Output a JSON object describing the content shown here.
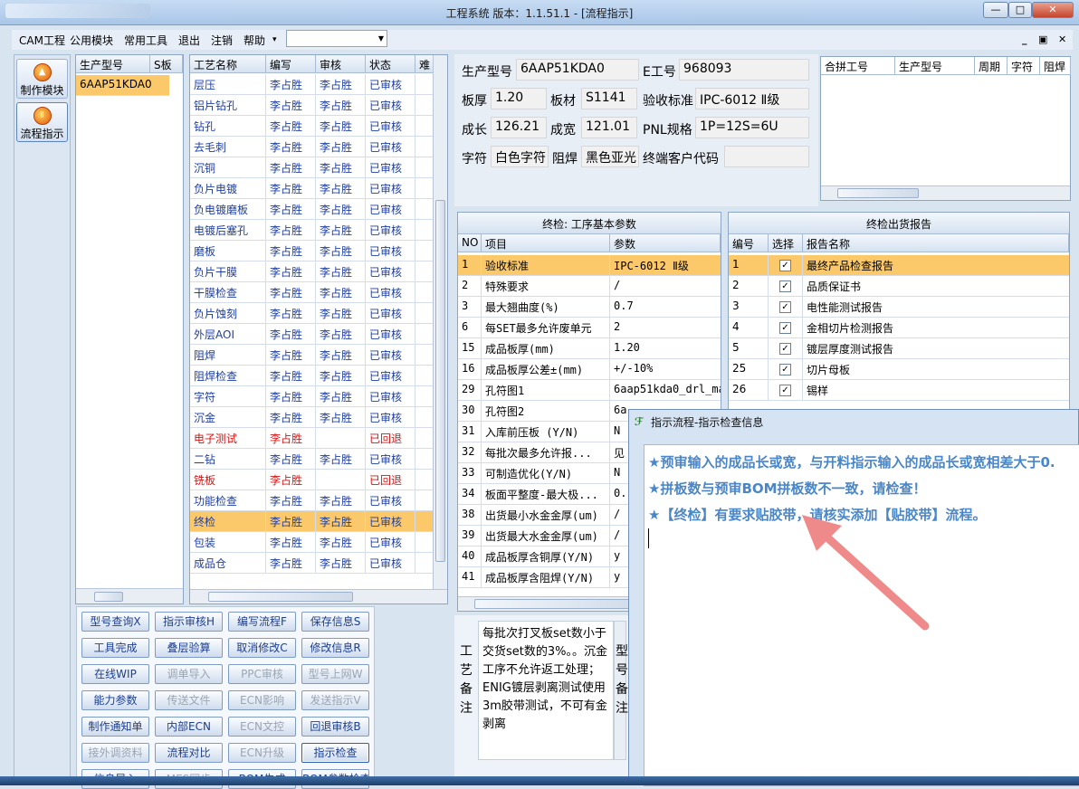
{
  "window": {
    "title": "工程系统  版本：1.1.51.1 - [流程指示]",
    "min": "—",
    "max": "□",
    "close": "✕"
  },
  "menu": {
    "items": [
      "CAM工程",
      "公用模块",
      "常用工具",
      "退出",
      "注销",
      "帮助"
    ],
    "help_arrow": "▾",
    "combo_value": "",
    "combo_arrow": "▼",
    "mdi_min": "_",
    "mdi_restore": "▣",
    "mdi_close": "✕"
  },
  "left_tools": [
    {
      "label": "制作模块",
      "icon": "flame-icon"
    },
    {
      "label": "流程指示",
      "icon": "pause-icon"
    }
  ],
  "model_list": {
    "headers": [
      "生产型号",
      "S板"
    ],
    "rows": [
      [
        "6AAP51KDA0",
        ""
      ]
    ]
  },
  "process": {
    "headers": [
      "工艺名称",
      "编写",
      "审核",
      "状态",
      "难"
    ],
    "rows": [
      {
        "name": "层压",
        "writer": "李占胜",
        "checker": "李占胜",
        "status": "已审核",
        "red": false
      },
      {
        "name": "铝片钻孔",
        "writer": "李占胜",
        "checker": "李占胜",
        "status": "已审核",
        "red": false
      },
      {
        "name": "钻孔",
        "writer": "李占胜",
        "checker": "李占胜",
        "status": "已审核",
        "red": false
      },
      {
        "name": "去毛刺",
        "writer": "李占胜",
        "checker": "李占胜",
        "status": "已审核",
        "red": false
      },
      {
        "name": "沉铜",
        "writer": "李占胜",
        "checker": "李占胜",
        "status": "已审核",
        "red": false
      },
      {
        "name": "负片电镀",
        "writer": "李占胜",
        "checker": "李占胜",
        "status": "已审核",
        "red": false
      },
      {
        "name": "负电镀磨板",
        "writer": "李占胜",
        "checker": "李占胜",
        "status": "已审核",
        "red": false
      },
      {
        "name": "电镀后塞孔",
        "writer": "李占胜",
        "checker": "李占胜",
        "status": "已审核",
        "red": false
      },
      {
        "name": "磨板",
        "writer": "李占胜",
        "checker": "李占胜",
        "status": "已审核",
        "red": false
      },
      {
        "name": "负片干膜",
        "writer": "李占胜",
        "checker": "李占胜",
        "status": "已审核",
        "red": false
      },
      {
        "name": "干膜检查",
        "writer": "李占胜",
        "checker": "李占胜",
        "status": "已审核",
        "red": false
      },
      {
        "name": "负片蚀刻",
        "writer": "李占胜",
        "checker": "李占胜",
        "status": "已审核",
        "red": false
      },
      {
        "name": "外层AOI",
        "writer": "李占胜",
        "checker": "李占胜",
        "status": "已审核",
        "red": false
      },
      {
        "name": "阻焊",
        "writer": "李占胜",
        "checker": "李占胜",
        "status": "已审核",
        "red": false
      },
      {
        "name": "阻焊检查",
        "writer": "李占胜",
        "checker": "李占胜",
        "status": "已审核",
        "red": false
      },
      {
        "name": "字符",
        "writer": "李占胜",
        "checker": "李占胜",
        "status": "已审核",
        "red": false
      },
      {
        "name": "沉金",
        "writer": "李占胜",
        "checker": "李占胜",
        "status": "已审核",
        "red": false
      },
      {
        "name": "电子测试",
        "writer": "李占胜",
        "checker": "",
        "status": "已回退",
        "red": true
      },
      {
        "name": "二钻",
        "writer": "李占胜",
        "checker": "李占胜",
        "status": "已审核",
        "red": false
      },
      {
        "name": "铣板",
        "writer": "李占胜",
        "checker": "",
        "status": "已回退",
        "red": true
      },
      {
        "name": "功能检查",
        "writer": "李占胜",
        "checker": "李占胜",
        "status": "已审核",
        "red": false
      },
      {
        "name": "终检",
        "writer": "李占胜",
        "checker": "李占胜",
        "status": "已审核",
        "red": false,
        "selected": true
      },
      {
        "name": "包装",
        "writer": "李占胜",
        "checker": "李占胜",
        "status": "已审核",
        "red": false
      },
      {
        "name": "成品仓",
        "writer": "李占胜",
        "checker": "李占胜",
        "status": "已审核",
        "red": false
      }
    ]
  },
  "info": {
    "model_label": "生产型号",
    "model": "6AAP51KDA0",
    "eno_label": "E工号",
    "eno": "968093",
    "thick_label": "板厚",
    "thick": "1.20",
    "material_label": "板材",
    "material": "S1141",
    "std_label": "验收标准",
    "std": "IPC-6012 Ⅱ级",
    "len_label": "成长",
    "len": "126.21",
    "width_label": "成宽",
    "width": "121.01",
    "pnl_label": "PNL规格",
    "pnl": "1P=12S=6U",
    "char_label": "字符",
    "char": "白色字符",
    "mask_label": "阻焊",
    "mask": "黑色亚光",
    "cust_label": "终端客户代码",
    "cust": ""
  },
  "merge_table": {
    "headers": [
      "合拼工号",
      "生产型号",
      "周期",
      "字符",
      "阻焊"
    ]
  },
  "params": {
    "title": "终检: 工序基本参数",
    "headers": [
      "NO",
      "项目",
      "参数"
    ],
    "rows": [
      [
        "1",
        "验收标准",
        "IPC-6012 Ⅱ级"
      ],
      [
        "2",
        "特殊要求",
        "/"
      ],
      [
        "3",
        "最大翘曲度(%)",
        "0.7"
      ],
      [
        "6",
        "每SET最多允许废单元",
        "2"
      ],
      [
        "15",
        "成品板厚(mm)",
        "1.20"
      ],
      [
        "16",
        "成品板厚公差±(mm)",
        "+/-10%"
      ],
      [
        "29",
        "孔符图1",
        "6aap51kda0_drl_ma"
      ],
      [
        "30",
        "孔符图2",
        "6a"
      ],
      [
        "31",
        "入库前压板 (Y/N)",
        "N"
      ],
      [
        "32",
        "每批次最多允许报...",
        "见"
      ],
      [
        "33",
        "可制造优化(Y/N)",
        "N"
      ],
      [
        "34",
        "板面平整度-最大极...",
        "0."
      ],
      [
        "38",
        "出货最小水金金厚(um)",
        "/"
      ],
      [
        "39",
        "出货最大水金金厚(um)",
        "/"
      ],
      [
        "40",
        "成品板厚含铜厚(Y/N)",
        "y"
      ],
      [
        "41",
        "成品板厚含阻焊(Y/N)",
        "y"
      ]
    ]
  },
  "reports": {
    "title": "终检出货报告",
    "headers": [
      "编号",
      "选择",
      "报告名称"
    ],
    "rows": [
      [
        "1",
        "最终产品检查报告"
      ],
      [
        "2",
        "品质保证书"
      ],
      [
        "3",
        "电性能测试报告"
      ],
      [
        "4",
        "金相切片检测报告"
      ],
      [
        "5",
        "镀层厚度测试报告"
      ],
      [
        "25",
        "切片母板"
      ],
      [
        "26",
        "锡样"
      ]
    ],
    "check": "✓"
  },
  "buttons": [
    {
      "label": "型号查询X",
      "enabled": true
    },
    {
      "label": "指示审核H",
      "enabled": true
    },
    {
      "label": "编写流程F",
      "enabled": true
    },
    {
      "label": "保存信息S",
      "enabled": true
    },
    {
      "label": "工具完成",
      "enabled": true
    },
    {
      "label": "叠层验算",
      "enabled": true
    },
    {
      "label": "取消修改C",
      "enabled": true
    },
    {
      "label": "修改信息R",
      "enabled": true
    },
    {
      "label": "在线WIP",
      "enabled": true
    },
    {
      "label": "调单导入",
      "enabled": false
    },
    {
      "label": "PPC审核",
      "enabled": false
    },
    {
      "label": "型号上网W",
      "enabled": false
    },
    {
      "label": "能力参数",
      "enabled": true
    },
    {
      "label": "传送文件",
      "enabled": false
    },
    {
      "label": "ECN影响",
      "enabled": false
    },
    {
      "label": "发送指示V",
      "enabled": false
    },
    {
      "label": "制作通知单",
      "enabled": true
    },
    {
      "label": "内部ECN",
      "enabled": true
    },
    {
      "label": "ECN文控",
      "enabled": false
    },
    {
      "label": "回退审核B",
      "enabled": true
    },
    {
      "label": "接外调资料",
      "enabled": false
    },
    {
      "label": "流程对比",
      "enabled": true
    },
    {
      "label": "ECN升级",
      "enabled": false
    },
    {
      "label": "指示检查",
      "enabled": true,
      "active": true
    },
    {
      "label": "信息导入",
      "enabled": true
    },
    {
      "label": "MES同步",
      "enabled": false
    },
    {
      "label": "BOM生成",
      "enabled": true
    },
    {
      "label": "BOM参数检查",
      "enabled": true
    }
  ],
  "remark": {
    "label": "工艺备注",
    "text": "每批次打叉板set数小于交货set数的3%。。沉金工序不允许返工处理；ENIG镀层剥离测试使用3m胶带测试，不可有金剥离",
    "label2": "型号备注"
  },
  "dialog": {
    "title": "指示流程-指示检查信息",
    "messages": [
      "★预审输入的成品长或宽，与开料指示输入的成品长或宽相差大于0.",
      "★拼板数与预审BOM拼板数不一致，请检查！",
      "★【终检】有要求贴胶带，请核实添加【贴胶带】流程。"
    ]
  },
  "colors": {
    "dialog_text": "#4a86c8",
    "selected_row": "#fbc86a",
    "returned": "#d41414",
    "arrow": "#ef8a8a"
  }
}
